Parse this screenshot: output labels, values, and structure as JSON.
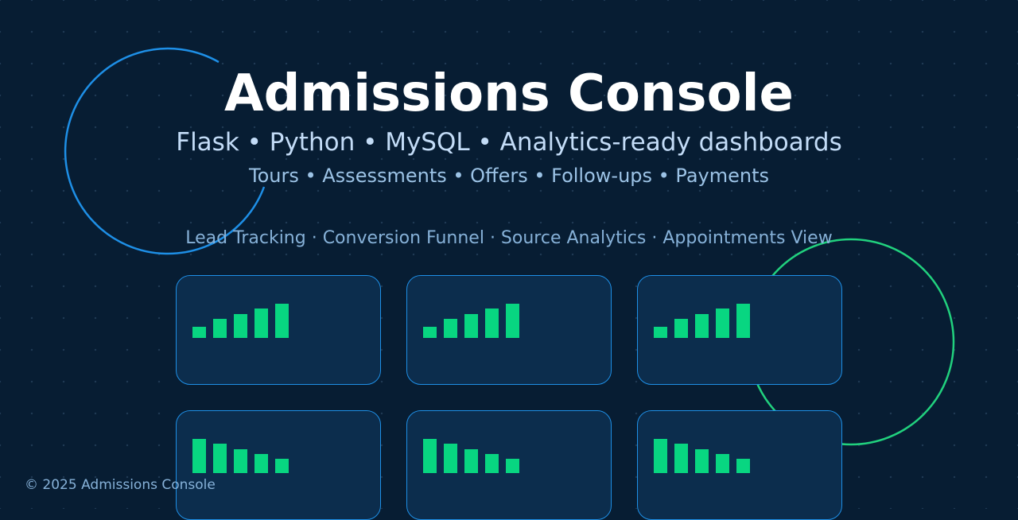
{
  "hero": {
    "title": "Admissions Console",
    "tech_line": "Flask • Python • MySQL • Analytics-ready dashboards",
    "workflow_line": "Tours • Assessments • Offers • Follow-ups • Payments",
    "features_line": "Lead Tracking · Conversion Funnel · Source Analytics · Appointments View"
  },
  "colors": {
    "background": "#071d33",
    "card_fill": "#0c2d4d",
    "card_border": "#1e8fe6",
    "bar": "#08d681",
    "ring_blue": "#1e8fe6",
    "ring_green": "#21d17e"
  },
  "card_charts": [
    {
      "trend": "rising",
      "bars": [
        0.33,
        0.55,
        0.7,
        0.85,
        1.0
      ]
    },
    {
      "trend": "rising",
      "bars": [
        0.33,
        0.55,
        0.7,
        0.85,
        1.0
      ]
    },
    {
      "trend": "rising",
      "bars": [
        0.33,
        0.55,
        0.7,
        0.85,
        1.0
      ]
    },
    {
      "trend": "falling",
      "bars": [
        1.0,
        0.86,
        0.7,
        0.56,
        0.42
      ]
    },
    {
      "trend": "falling",
      "bars": [
        1.0,
        0.86,
        0.7,
        0.56,
        0.42
      ]
    },
    {
      "trend": "falling",
      "bars": [
        1.0,
        0.86,
        0.7,
        0.56,
        0.42
      ]
    }
  ],
  "footer": {
    "copyright": "© 2025 Admissions Console"
  }
}
